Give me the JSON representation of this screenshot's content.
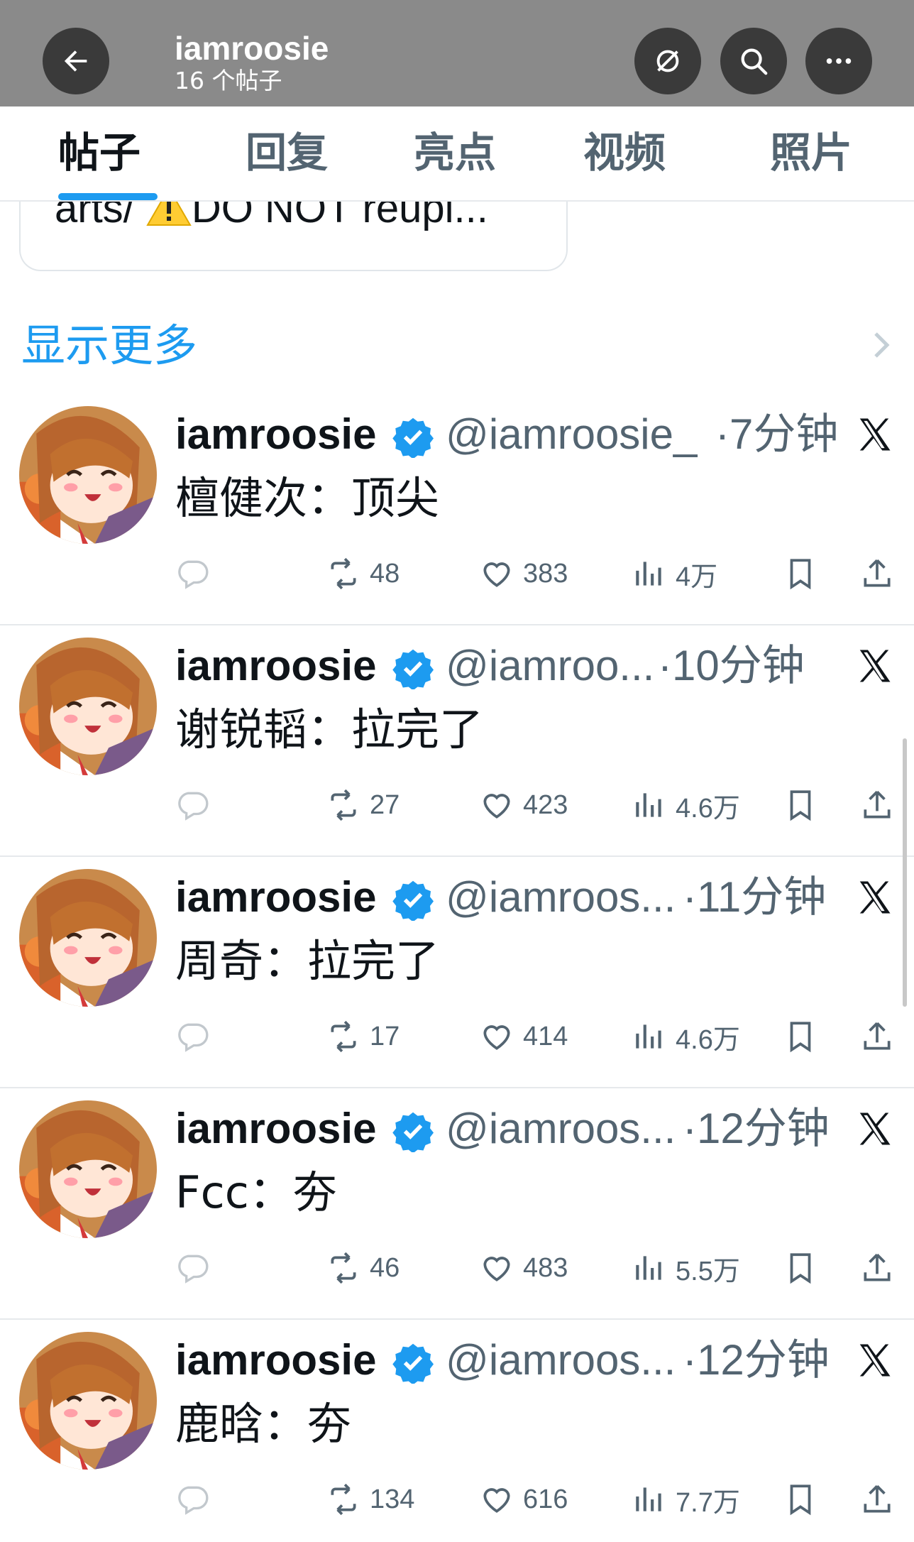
{
  "header": {
    "title": "iamroosie",
    "subtitle": "16 个帖子",
    "icons": [
      "back-arrow-icon",
      "grok-icon",
      "search-icon",
      "more-icon"
    ]
  },
  "tabs": [
    {
      "label": "帖子",
      "active": true
    },
    {
      "label": "回复",
      "active": false
    },
    {
      "label": "亮点",
      "active": false
    },
    {
      "label": "视频",
      "active": false
    },
    {
      "label": "照片",
      "active": false
    }
  ],
  "card": {
    "text": "arts/ ⚠️DO NOT reupl..."
  },
  "show_more": "显示更多",
  "tweets": [
    {
      "name": "iamroosie",
      "handle": "@iamroosie_",
      "time": "·7分钟",
      "text": "檀健次：顶尖",
      "retweets": "48",
      "likes": "383",
      "views": "4万"
    },
    {
      "name": "iamroosie",
      "handle": "@iamroo...",
      "time": "·10分钟",
      "text": "谢锐韬：拉完了",
      "retweets": "27",
      "likes": "423",
      "views": "4.6万"
    },
    {
      "name": "iamroosie",
      "handle": "@iamroos...",
      "time": "·11分钟",
      "text": "周奇：拉完了",
      "retweets": "17",
      "likes": "414",
      "views": "4.6万"
    },
    {
      "name": "iamroosie",
      "handle": "@iamroos...",
      "time": "·12分钟",
      "text": "Fcc：夯",
      "retweets": "46",
      "likes": "483",
      "views": "5.5万"
    },
    {
      "name": "iamroosie",
      "handle": "@iamroos...",
      "time": "·12分钟",
      "text": "鹿晗：夯",
      "retweets": "134",
      "likes": "616",
      "views": "7.7万"
    }
  ],
  "colors": {
    "accent": "#1d9bf0",
    "header_bg": "#8a8a8a",
    "muted": "#536471"
  }
}
